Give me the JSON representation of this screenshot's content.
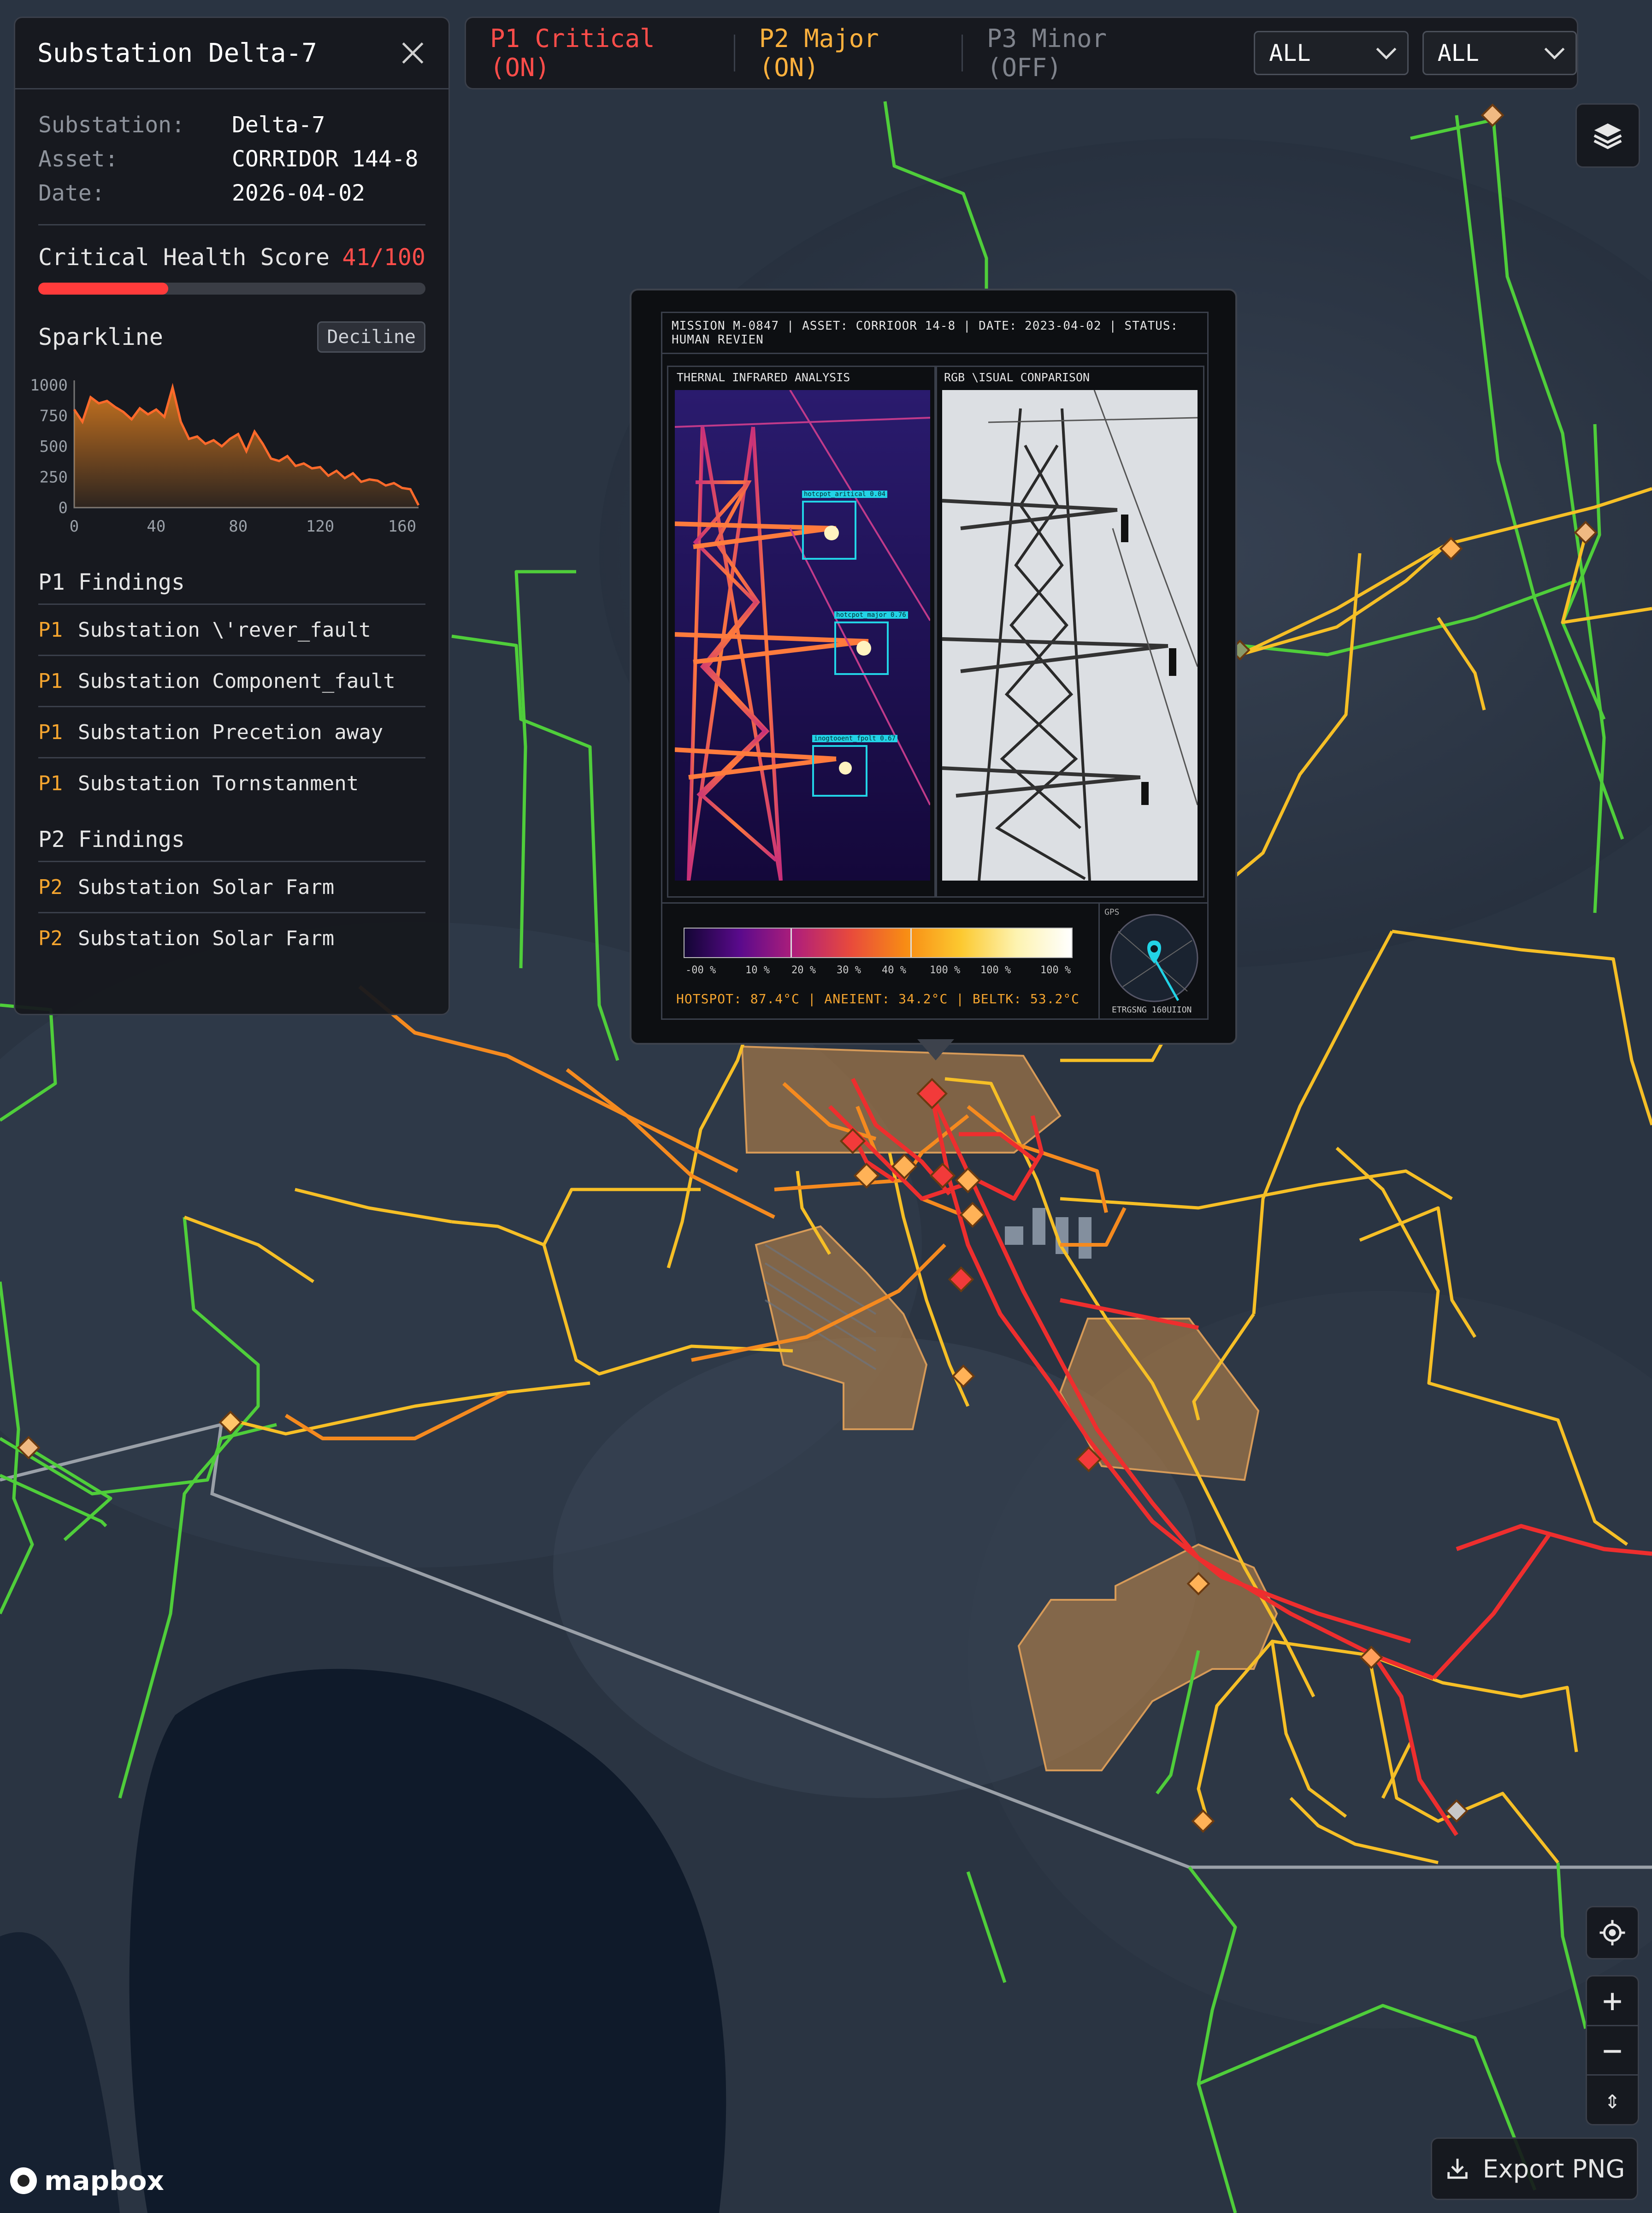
{
  "panel": {
    "title": "Substation Delta-7",
    "meta": [
      {
        "label": "Substation:",
        "value": "Delta-7"
      },
      {
        "label": "Asset:",
        "value": "CORRIDOR 144-8"
      },
      {
        "label": "Date:",
        "value": "2026-04-02"
      }
    ],
    "score_label": "Critical Health Score",
    "score_value": "41/100",
    "score_fraction": 0.41,
    "sparkline_label": "Sparkline",
    "decile_label": "Deciline",
    "p1_title": "P1 Findings",
    "p1_items": [
      {
        "prio": "P1",
        "text": "Substation \\'rever_fault"
      },
      {
        "prio": "P1",
        "text": "Substation Component_fault"
      },
      {
        "prio": "P1",
        "text": "Substation Precetion away"
      },
      {
        "prio": "P1",
        "text": "Substation Tornstanment"
      }
    ],
    "p2_title": "P2 Findings",
    "p2_items": [
      {
        "prio": "P2",
        "text": "Substation Solar Farm"
      },
      {
        "prio": "P2",
        "text": "Substation Solar Farm"
      }
    ]
  },
  "filters": {
    "critical": "P1 Critical (ON)",
    "major": "P2 Major (ON)",
    "minor": "P3 Minor (OFF)",
    "dropdown1": "ALL",
    "dropdown2": "ALL"
  },
  "popup": {
    "header": "MISSION M-0847 | ASSET: CORRIOOR 14-8 | DATE: 2023-04-02 | STATUS: HUMAN REVIEN",
    "thermal_title": "THERNAL INFRARED ANALYSIS",
    "rgb_title": "RGB \\ISUAL CONPARISON",
    "detections": [
      "hotcpot_aritical 0.04",
      "hotcpot_major 0.76",
      "inogtooent_fpolt 0.67"
    ],
    "scale_labels": [
      "-00 %",
      "10 %",
      "20 %",
      "30 %",
      "40 %",
      "100 %",
      "100 %",
      "100 %"
    ],
    "readout": "HOTSPOT: 87.4°C | ANEIENT: 34.2°C | BELTK: 53.2°C",
    "gps_label": "GPS",
    "gps_caption": "ETRGSNG 160UIION"
  },
  "controls": {
    "zoom_in": "+",
    "zoom_out": "−",
    "compass": "⇕",
    "export_label": "Export PNG"
  },
  "brand": {
    "logo_text": "mapbox"
  },
  "colors": {
    "critical": "#ff4d4a",
    "major": "#ffb13d",
    "minor": "#7f838c",
    "line_green": "#4fce3a",
    "line_yellow": "#f6bf26",
    "line_orange": "#f58a1f",
    "line_red": "#ee2e2e"
  },
  "chart_data": {
    "type": "area",
    "title": "Sparkline",
    "x_ticks": [
      0,
      40,
      80,
      120,
      160
    ],
    "y_ticks": [
      0,
      250,
      500,
      750,
      1000
    ],
    "xlim": [
      0,
      168
    ],
    "ylim": [
      0,
      1000
    ],
    "x": [
      0,
      4,
      8,
      12,
      16,
      20,
      24,
      28,
      32,
      36,
      40,
      44,
      48,
      52,
      56,
      60,
      64,
      68,
      72,
      76,
      80,
      84,
      88,
      92,
      96,
      100,
      104,
      108,
      112,
      116,
      120,
      124,
      128,
      132,
      136,
      140,
      144,
      148,
      152,
      156,
      160,
      164,
      168
    ],
    "y": [
      800,
      700,
      900,
      850,
      870,
      820,
      780,
      720,
      810,
      760,
      800,
      740,
      980,
      700,
      560,
      580,
      520,
      550,
      500,
      560,
      600,
      460,
      620,
      520,
      400,
      380,
      420,
      340,
      360,
      320,
      330,
      260,
      300,
      240,
      280,
      210,
      230,
      220,
      180,
      200,
      160,
      150,
      20
    ]
  }
}
